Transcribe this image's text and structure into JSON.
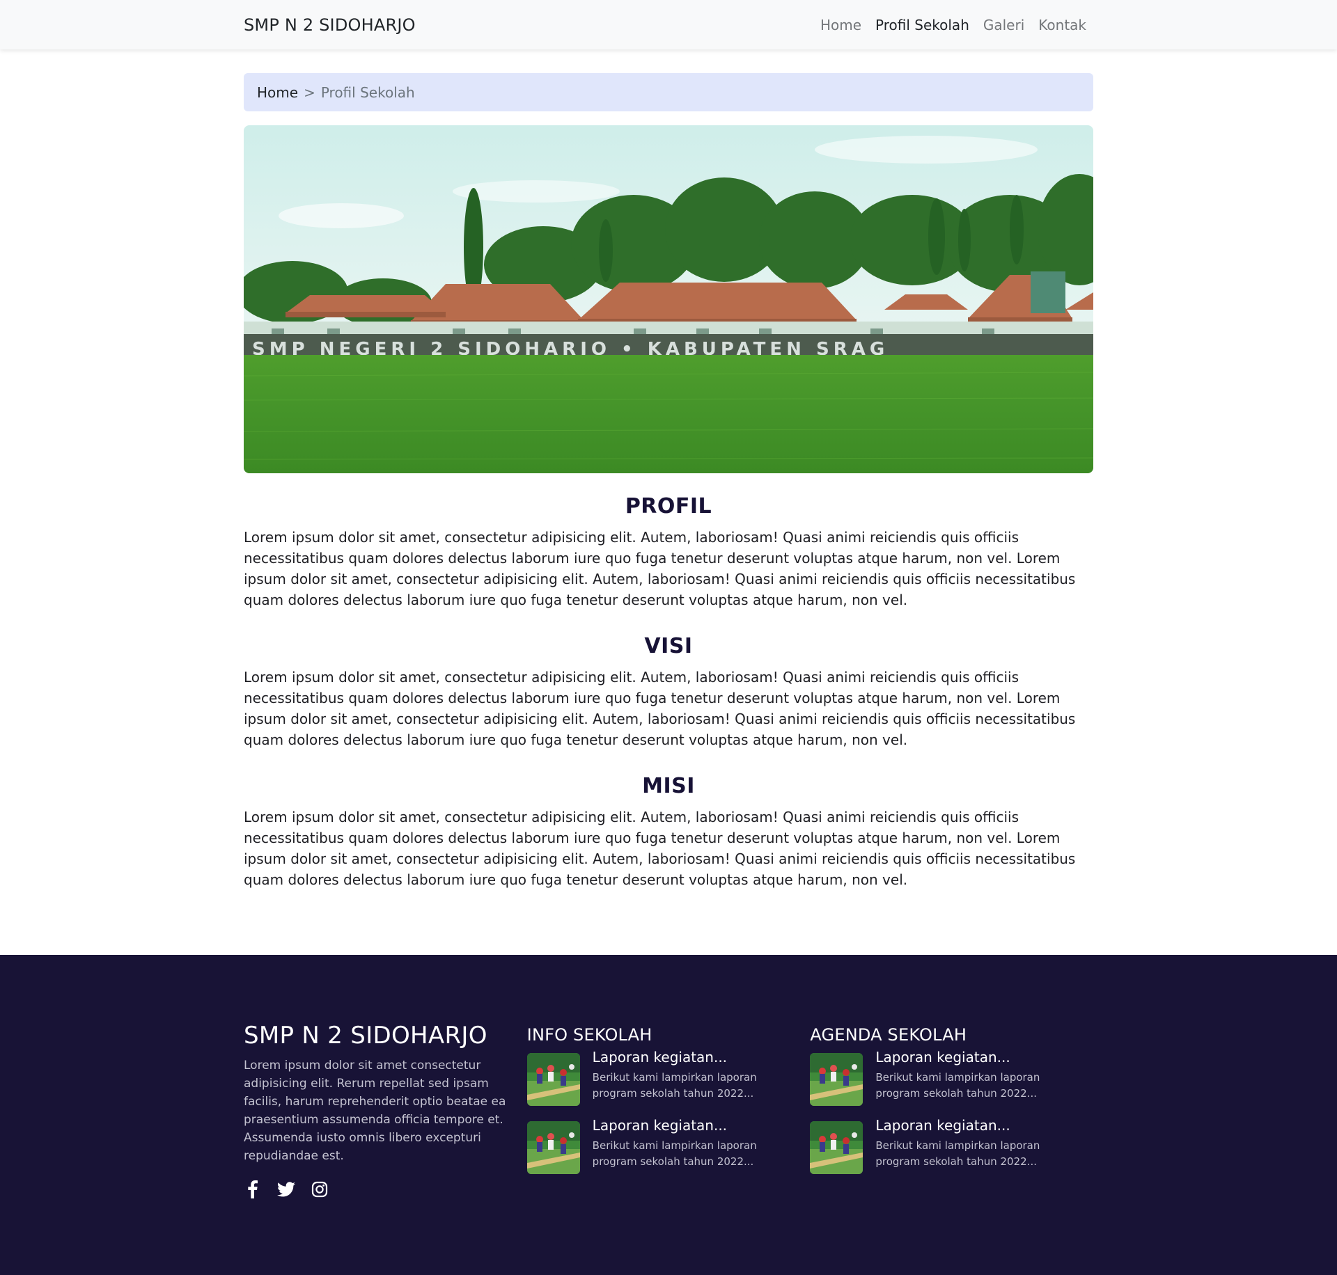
{
  "navbar": {
    "brand": "SMP N 2 SIDOHARJO",
    "links": [
      {
        "label": "Home"
      },
      {
        "label": "Profil Sekolah",
        "active": true
      },
      {
        "label": "Galeri"
      },
      {
        "label": "Kontak"
      }
    ]
  },
  "breadcrumb": {
    "home": "Home",
    "separator": ">",
    "current": "Profil Sekolah"
  },
  "hero": {
    "sign_text": "SMP NEGERI 2 SIDOHARJO • KABUPATEN SRAG"
  },
  "sections": [
    {
      "title": "PROFIL",
      "text": "Lorem ipsum dolor sit amet, consectetur adipisicing elit. Autem, laboriosam! Quasi animi reiciendis quis officiis necessitatibus quam dolores delectus laborum iure quo fuga tenetur deserunt voluptas atque harum, non vel. Lorem ipsum dolor sit amet, consectetur adipisicing elit. Autem, laboriosam! Quasi animi reiciendis quis officiis necessitatibus quam dolores delectus laborum iure quo fuga tenetur deserunt voluptas atque harum, non vel."
    },
    {
      "title": "VISI",
      "text": "Lorem ipsum dolor sit amet, consectetur adipisicing elit. Autem, laboriosam! Quasi animi reiciendis quis officiis necessitatibus quam dolores delectus laborum iure quo fuga tenetur deserunt voluptas atque harum, non vel. Lorem ipsum dolor sit amet, consectetur adipisicing elit. Autem, laboriosam! Quasi animi reiciendis quis officiis necessitatibus quam dolores delectus laborum iure quo fuga tenetur deserunt voluptas atque harum, non vel."
    },
    {
      "title": "MISI",
      "text": "Lorem ipsum dolor sit amet, consectetur adipisicing elit. Autem, laboriosam! Quasi animi reiciendis quis officiis necessitatibus quam dolores delectus laborum iure quo fuga tenetur deserunt voluptas atque harum, non vel. Lorem ipsum dolor sit amet, consectetur adipisicing elit. Autem, laboriosam! Quasi animi reiciendis quis officiis necessitatibus quam dolores delectus laborum iure quo fuga tenetur deserunt voluptas atque harum, non vel."
    }
  ],
  "footer": {
    "about": {
      "title": "SMP N 2 SIDOHARJO",
      "text": "Lorem ipsum dolor sit amet consectetur adipisicing elit. Rerum repellat sed ipsam facilis, harum reprehenderit optio beatae ea praesentium assumenda officia tempore et. Assumenda iusto omnis libero excepturi repudiandae est.",
      "social_icons": [
        "facebook-icon",
        "twitter-icon",
        "instagram-icon"
      ]
    },
    "info": {
      "title": "INFO SEKOLAH",
      "items": [
        {
          "title": "Laporan kegiatan...",
          "desc": "Berikut kami lampirkan laporan program sekolah tahun 2022..."
        },
        {
          "title": "Laporan kegiatan...",
          "desc": "Berikut kami lampirkan laporan program sekolah tahun 2022..."
        }
      ]
    },
    "agenda": {
      "title": "AGENDA SEKOLAH",
      "items": [
        {
          "title": "Laporan kegiatan...",
          "desc": "Berikut kami lampirkan laporan program sekolah tahun 2022..."
        },
        {
          "title": "Laporan kegiatan...",
          "desc": "Berikut kami lampirkan laporan program sekolah tahun 2022..."
        }
      ]
    }
  },
  "colors": {
    "navbar_bg": "#f8f9fa",
    "breadcrumb_bg": "#e0e6fb",
    "heading": "#171236",
    "footer_bg": "#181336"
  }
}
